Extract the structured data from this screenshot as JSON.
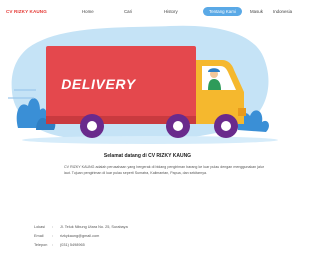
{
  "navbar": {
    "brand": "CV RIZKY KAUNG",
    "items": [
      {
        "label": "Home"
      },
      {
        "label": "Cari"
      },
      {
        "label": "History"
      },
      {
        "label": "Tentang Kami"
      },
      {
        "label": "Masuk"
      },
      {
        "label": "Indonesia"
      }
    ]
  },
  "hero": {
    "title": "DELIVERY"
  },
  "about": {
    "welcome": "Selamat datang di CV RIZKY KAUNG",
    "description": "CV RIZKY KAUNG adalah perusahaan yang bergerak di bidang pengiriman barang ke luar pulau dengan menggunakan jalur laut. Tujuan pengiriman di luar pulau seperti Sumatra, Kalimantan, Papua, dan sekitarnya.",
    "info": [
      {
        "label": "Lokasi",
        "value": "Jl. Teluk Nibung Utara No. 25, Surabaya"
      },
      {
        "label": "Email",
        "value": "rizkykaung@gmail.com"
      },
      {
        "label": "Telepon",
        "value": "(031) 5498965"
      }
    ]
  },
  "colors": {
    "brand_red": "#e53935",
    "accent_blue": "#5aa9e6",
    "truck_box": "#e4484d",
    "truck_cab": "#f5b82e",
    "sky_blob": "#c5e3f6"
  }
}
